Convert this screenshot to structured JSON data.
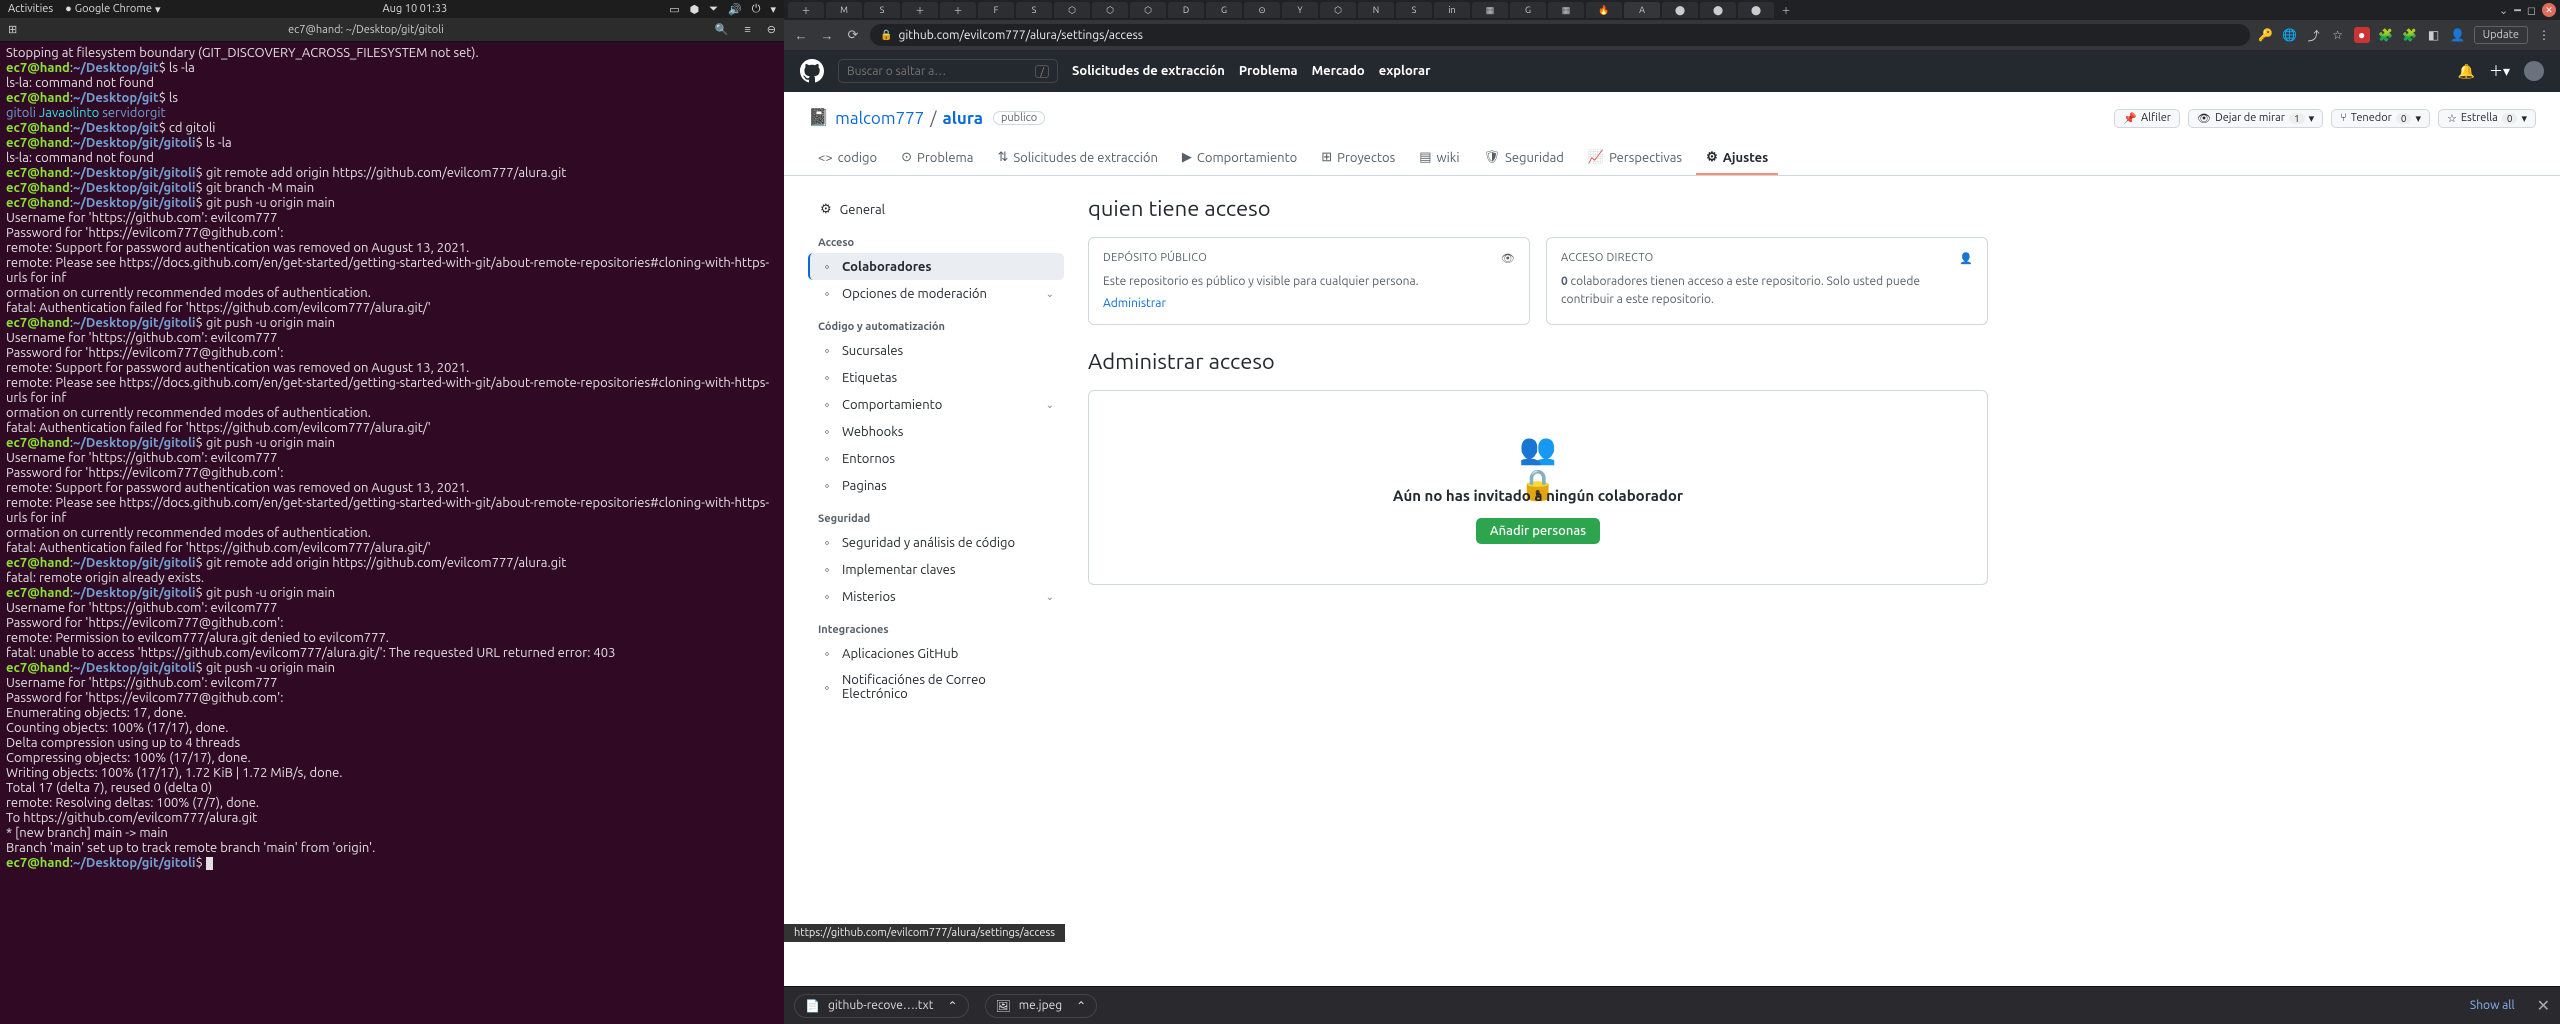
{
  "gnome_bar": {
    "activities": "Activities",
    "app": "Google Chrome",
    "clock": "Aug 10  01:33"
  },
  "terminal": {
    "title": "ec7@hand: ~/Desktop/git/gitoli",
    "lines": [
      {
        "t": "out",
        "text": "Stopping at filesystem boundary (GIT_DISCOVERY_ACROSS_FILESYSTEM not set)."
      },
      {
        "t": "p",
        "path": "~/Desktop/git",
        "cmd": "ls -la"
      },
      {
        "t": "out",
        "text": "ls-la: command not found"
      },
      {
        "t": "p",
        "path": "~/Desktop/git",
        "cmd": "ls"
      },
      {
        "t": "dirs",
        "items": [
          [
            "gitoli",
            "b"
          ],
          [
            "Javaolinto",
            "c"
          ],
          [
            "servidorgit",
            "b"
          ]
        ]
      },
      {
        "t": "p",
        "path": "~/Desktop/git",
        "cmd": "cd gitoli"
      },
      {
        "t": "p",
        "path": "~/Desktop/git/gitoli",
        "cmd": "ls -la"
      },
      {
        "t": "out",
        "text": "ls-la: command not found"
      },
      {
        "t": "p",
        "path": "~/Desktop/git/gitoli",
        "cmd": "git remote add origin https://github.com/evilcom777/alura.git"
      },
      {
        "t": "p",
        "path": "~/Desktop/git/gitoli",
        "cmd": "git branch -M main"
      },
      {
        "t": "p",
        "path": "~/Desktop/git/gitoli",
        "cmd": "git push -u origin main"
      },
      {
        "t": "out",
        "text": "Username for 'https://github.com': evilcom777"
      },
      {
        "t": "out",
        "text": "Password for 'https://evilcom777@github.com':"
      },
      {
        "t": "out",
        "text": "remote: Support for password authentication was removed on August 13, 2021."
      },
      {
        "t": "out",
        "text": "remote: Please see https://docs.github.com/en/get-started/getting-started-with-git/about-remote-repositories#cloning-with-https-urls for inf"
      },
      {
        "t": "out",
        "text": "ormation on currently recommended modes of authentication."
      },
      {
        "t": "out",
        "text": "fatal: Authentication failed for 'https://github.com/evilcom777/alura.git/'"
      },
      {
        "t": "p",
        "path": "~/Desktop/git/gitoli",
        "cmd": "git push -u origin main"
      },
      {
        "t": "out",
        "text": "Username for 'https://github.com': evilcom777"
      },
      {
        "t": "out",
        "text": "Password for 'https://evilcom777@github.com':"
      },
      {
        "t": "out",
        "text": "remote: Support for password authentication was removed on August 13, 2021."
      },
      {
        "t": "out",
        "text": "remote: Please see https://docs.github.com/en/get-started/getting-started-with-git/about-remote-repositories#cloning-with-https-urls for inf"
      },
      {
        "t": "out",
        "text": "ormation on currently recommended modes of authentication."
      },
      {
        "t": "out",
        "text": "fatal: Authentication failed for 'https://github.com/evilcom777/alura.git/'"
      },
      {
        "t": "p",
        "path": "~/Desktop/git/gitoli",
        "cmd": "git push -u origin main"
      },
      {
        "t": "out",
        "text": "Username for 'https://github.com': evilcom777"
      },
      {
        "t": "out",
        "text": "Password for 'https://evilcom777@github.com':"
      },
      {
        "t": "out",
        "text": "remote: Support for password authentication was removed on August 13, 2021."
      },
      {
        "t": "out",
        "text": "remote: Please see https://docs.github.com/en/get-started/getting-started-with-git/about-remote-repositories#cloning-with-https-urls for inf"
      },
      {
        "t": "out",
        "text": "ormation on currently recommended modes of authentication."
      },
      {
        "t": "out",
        "text": "fatal: Authentication failed for 'https://github.com/evilcom777/alura.git/'"
      },
      {
        "t": "p",
        "path": "~/Desktop/git/gitoli",
        "cmd": "git remote add origin https://github.com/evilcom777/alura.git"
      },
      {
        "t": "out",
        "text": "fatal: remote origin already exists."
      },
      {
        "t": "p",
        "path": "~/Desktop/git/gitoli",
        "cmd": "git push -u origin main"
      },
      {
        "t": "out",
        "text": "Username for 'https://github.com': evilcom777"
      },
      {
        "t": "out",
        "text": "Password for 'https://evilcom777@github.com':"
      },
      {
        "t": "out",
        "text": "remote: Permission to evilcom777/alura.git denied to evilcom777."
      },
      {
        "t": "out",
        "text": "fatal: unable to access 'https://github.com/evilcom777/alura.git/': The requested URL returned error: 403"
      },
      {
        "t": "p",
        "path": "~/Desktop/git/gitoli",
        "cmd": "git push -u origin main"
      },
      {
        "t": "out",
        "text": "Username for 'https://github.com': evilcom777"
      },
      {
        "t": "out",
        "text": "Password for 'https://evilcom777@github.com':"
      },
      {
        "t": "out",
        "text": "Enumerating objects: 17, done."
      },
      {
        "t": "out",
        "text": "Counting objects: 100% (17/17), done."
      },
      {
        "t": "out",
        "text": "Delta compression using up to 4 threads"
      },
      {
        "t": "out",
        "text": "Compressing objects: 100% (17/17), done."
      },
      {
        "t": "out",
        "text": "Writing objects: 100% (17/17), 1.72 KiB | 1.72 MiB/s, done."
      },
      {
        "t": "out",
        "text": "Total 17 (delta 7), reused 0 (delta 0)"
      },
      {
        "t": "out",
        "text": "remote: Resolving deltas: 100% (7/7), done."
      },
      {
        "t": "out",
        "text": "To https://github.com/evilcom777/alura.git"
      },
      {
        "t": "out",
        "text": " * [new branch]      main -> main"
      },
      {
        "t": "out",
        "text": "Branch 'main' set up to track remote branch 'main' from 'origin'."
      },
      {
        "t": "p",
        "path": "~/Desktop/git/gitoli",
        "cmd": "",
        "cursor": true
      }
    ]
  },
  "chrome": {
    "url_display": "github.com/evilcom777/alura/settings/access",
    "update_label": "Update"
  },
  "github": {
    "search_placeholder": "Buscar o saltar a…",
    "nav": [
      "Solicitudes de extracción",
      "Problema",
      "Mercado",
      "explorar"
    ],
    "owner": "malcom777",
    "repo": "alura",
    "visibility": "publico",
    "repo_buttons": {
      "pin": "Alfiler",
      "watch": "Dejar de mirar",
      "watch_count": "1",
      "fork": "Tenedor",
      "fork_count": "0",
      "star": "Estrella",
      "star_count": "0"
    },
    "tabs": [
      {
        "icon": "<>",
        "label": "codigo"
      },
      {
        "icon": "⊙",
        "label": "Problema"
      },
      {
        "icon": "⇅",
        "label": "Solicitudes de extracción"
      },
      {
        "icon": "▶",
        "label": "Comportamiento"
      },
      {
        "icon": "⊞",
        "label": "Proyectos"
      },
      {
        "icon": "▤",
        "label": "wiki"
      },
      {
        "icon": "🛡",
        "label": "Seguridad"
      },
      {
        "icon": "📈",
        "label": "Perspectivas"
      },
      {
        "icon": "⚙",
        "label": "Ajustes",
        "active": true
      }
    ],
    "sidebar": {
      "general": "General",
      "groups": [
        {
          "title": "Acceso",
          "items": [
            {
              "label": "Colaboradores",
              "active": true
            },
            {
              "label": "Opciones de moderación",
              "chev": true
            }
          ]
        },
        {
          "title": "Código y automatización",
          "items": [
            {
              "label": "Sucursales"
            },
            {
              "label": "Etiquetas"
            },
            {
              "label": "Comportamiento",
              "chev": true
            },
            {
              "label": "Webhooks"
            },
            {
              "label": "Entornos"
            },
            {
              "label": "Paginas"
            }
          ]
        },
        {
          "title": "Seguridad",
          "items": [
            {
              "label": "Seguridad y análisis de código"
            },
            {
              "label": "Implementar claves"
            },
            {
              "label": "Misterios",
              "chev": true
            }
          ]
        },
        {
          "title": "Integraciones",
          "items": [
            {
              "label": "Aplicaciones GitHub"
            },
            {
              "label": "Notificaciónes de Correo Electrónico"
            }
          ]
        }
      ]
    },
    "main": {
      "h1": "quien tiene acceso",
      "card1_head": "DEPÓSITO PÚBLICO",
      "card1_text": "Este repositorio es público y visible para cualquier persona.",
      "card1_link": "Administrar",
      "card2_head": "ACCESO DIRECTO",
      "card2_text_pre": "0",
      "card2_text": " colaboradores tienen acceso a este repositorio. Solo usted puede contribuir a este repositorio.",
      "h2": "Administrar acceso",
      "blank_title": "Aún no has invitado a ningún colaborador",
      "add_btn": "Añadir personas"
    },
    "status_url": "https://github.com/evilcom777/alura/settings/access"
  },
  "downloads": {
    "items": [
      {
        "icon": "📄",
        "name": "github-recove….txt"
      },
      {
        "icon": "🖼",
        "name": "me.jpeg"
      }
    ],
    "showall": "Show all"
  }
}
